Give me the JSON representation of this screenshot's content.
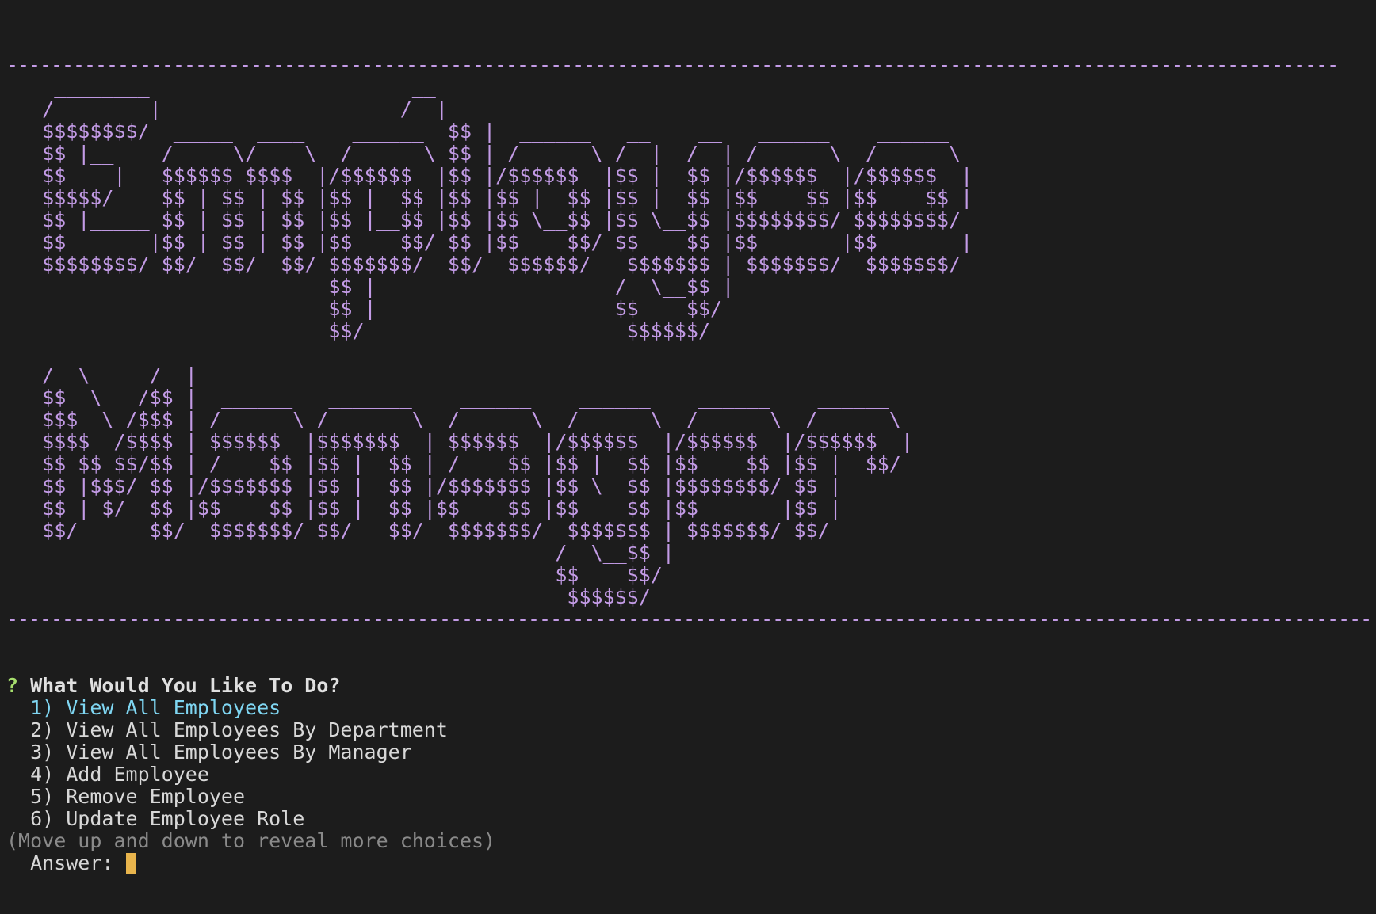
{
  "banner": {
    "top_rule": "------------------------------------------------------------------------------------------------------------------------",
    "bottom_rule": "---------------------------------------------------------------------------------------------------------------------------"
  },
  "ascii_art": {
    "employee": [
      "    ________                      __",
      "   /        |                    /  |",
      "   $$$$$$$$/  _____  ____    ______  $$ |  ______   __    __   ______    ______",
      "   $$ |__    /     \\/    \\  /      \\ $$ | /      \\ /  |  /  | /      \\  /      \\",
      "   $$    |   $$$$$$ $$$$  |/$$$$$$  |$$ |/$$$$$$  |$$ |  $$ |/$$$$$$  |/$$$$$$  |",
      "   $$$$$/    $$ | $$ | $$ |$$ |  $$ |$$ |$$ |  $$ |$$ |  $$ |$$    $$ |$$    $$ |",
      "   $$ |_____ $$ | $$ | $$ |$$ |__$$ |$$ |$$ \\__$$ |$$ \\__$$ |$$$$$$$$/ $$$$$$$$/",
      "   $$       |$$ | $$ | $$ |$$    $$/ $$ |$$    $$/ $$    $$ |$$       |$$       |",
      "   $$$$$$$$/ $$/  $$/  $$/ $$$$$$$/  $$/  $$$$$$/   $$$$$$$ | $$$$$$$/  $$$$$$$/",
      "                           $$ |                    /  \\__$$ |",
      "                           $$ |                    $$    $$/",
      "                           $$/                      $$$$$$/"
    ],
    "manager": [
      "    __       __",
      "   /  \\     /  |",
      "   $$  \\   /$$ |  ______   _______    ______    ______    ______    ______",
      "   $$$  \\ /$$$ | /      \\ /       \\  /      \\  /      \\  /      \\  /      \\",
      "   $$$$  /$$$$ | $$$$$$  |$$$$$$$  | $$$$$$  |/$$$$$$  |/$$$$$$  |/$$$$$$  |",
      "   $$ $$ $$/$$ | /    $$ |$$ |  $$ | /    $$ |$$ |  $$ |$$    $$ |$$ |  $$/",
      "   $$ |$$$/ $$ |/$$$$$$$ |$$ |  $$ |/$$$$$$$ |$$ \\__$$ |$$$$$$$$/ $$ |",
      "   $$ | $/  $$ |$$    $$ |$$ |  $$ |$$    $$ |$$    $$ |$$       |$$ |",
      "   $$/      $$/  $$$$$$$/ $$/   $$/  $$$$$$$/  $$$$$$$ | $$$$$$$/ $$/",
      "                                              /  \\__$$ |",
      "                                              $$    $$/",
      "                                               $$$$$$/"
    ]
  },
  "prompt": {
    "qmark": "?",
    "question": "What Would You Like To Do?",
    "choices": [
      "  1) View All Employees",
      "  2) View All Employees By Department",
      "  3) View All Employees By Manager",
      "  4) Add Employee",
      "  5) Remove Employee",
      "  6) Update Employee Role"
    ],
    "selected_index": 0,
    "hint": "(Move up and down to reveal more choices)",
    "answer_label": "  Answer: "
  },
  "colors": {
    "background": "#1c1c1c",
    "ascii_art": "#c39be6",
    "qmark": "#a6de6d",
    "selected_choice": "#7fd6f2",
    "hint": "#8a8a8a",
    "cursor": "#e8b44c"
  }
}
